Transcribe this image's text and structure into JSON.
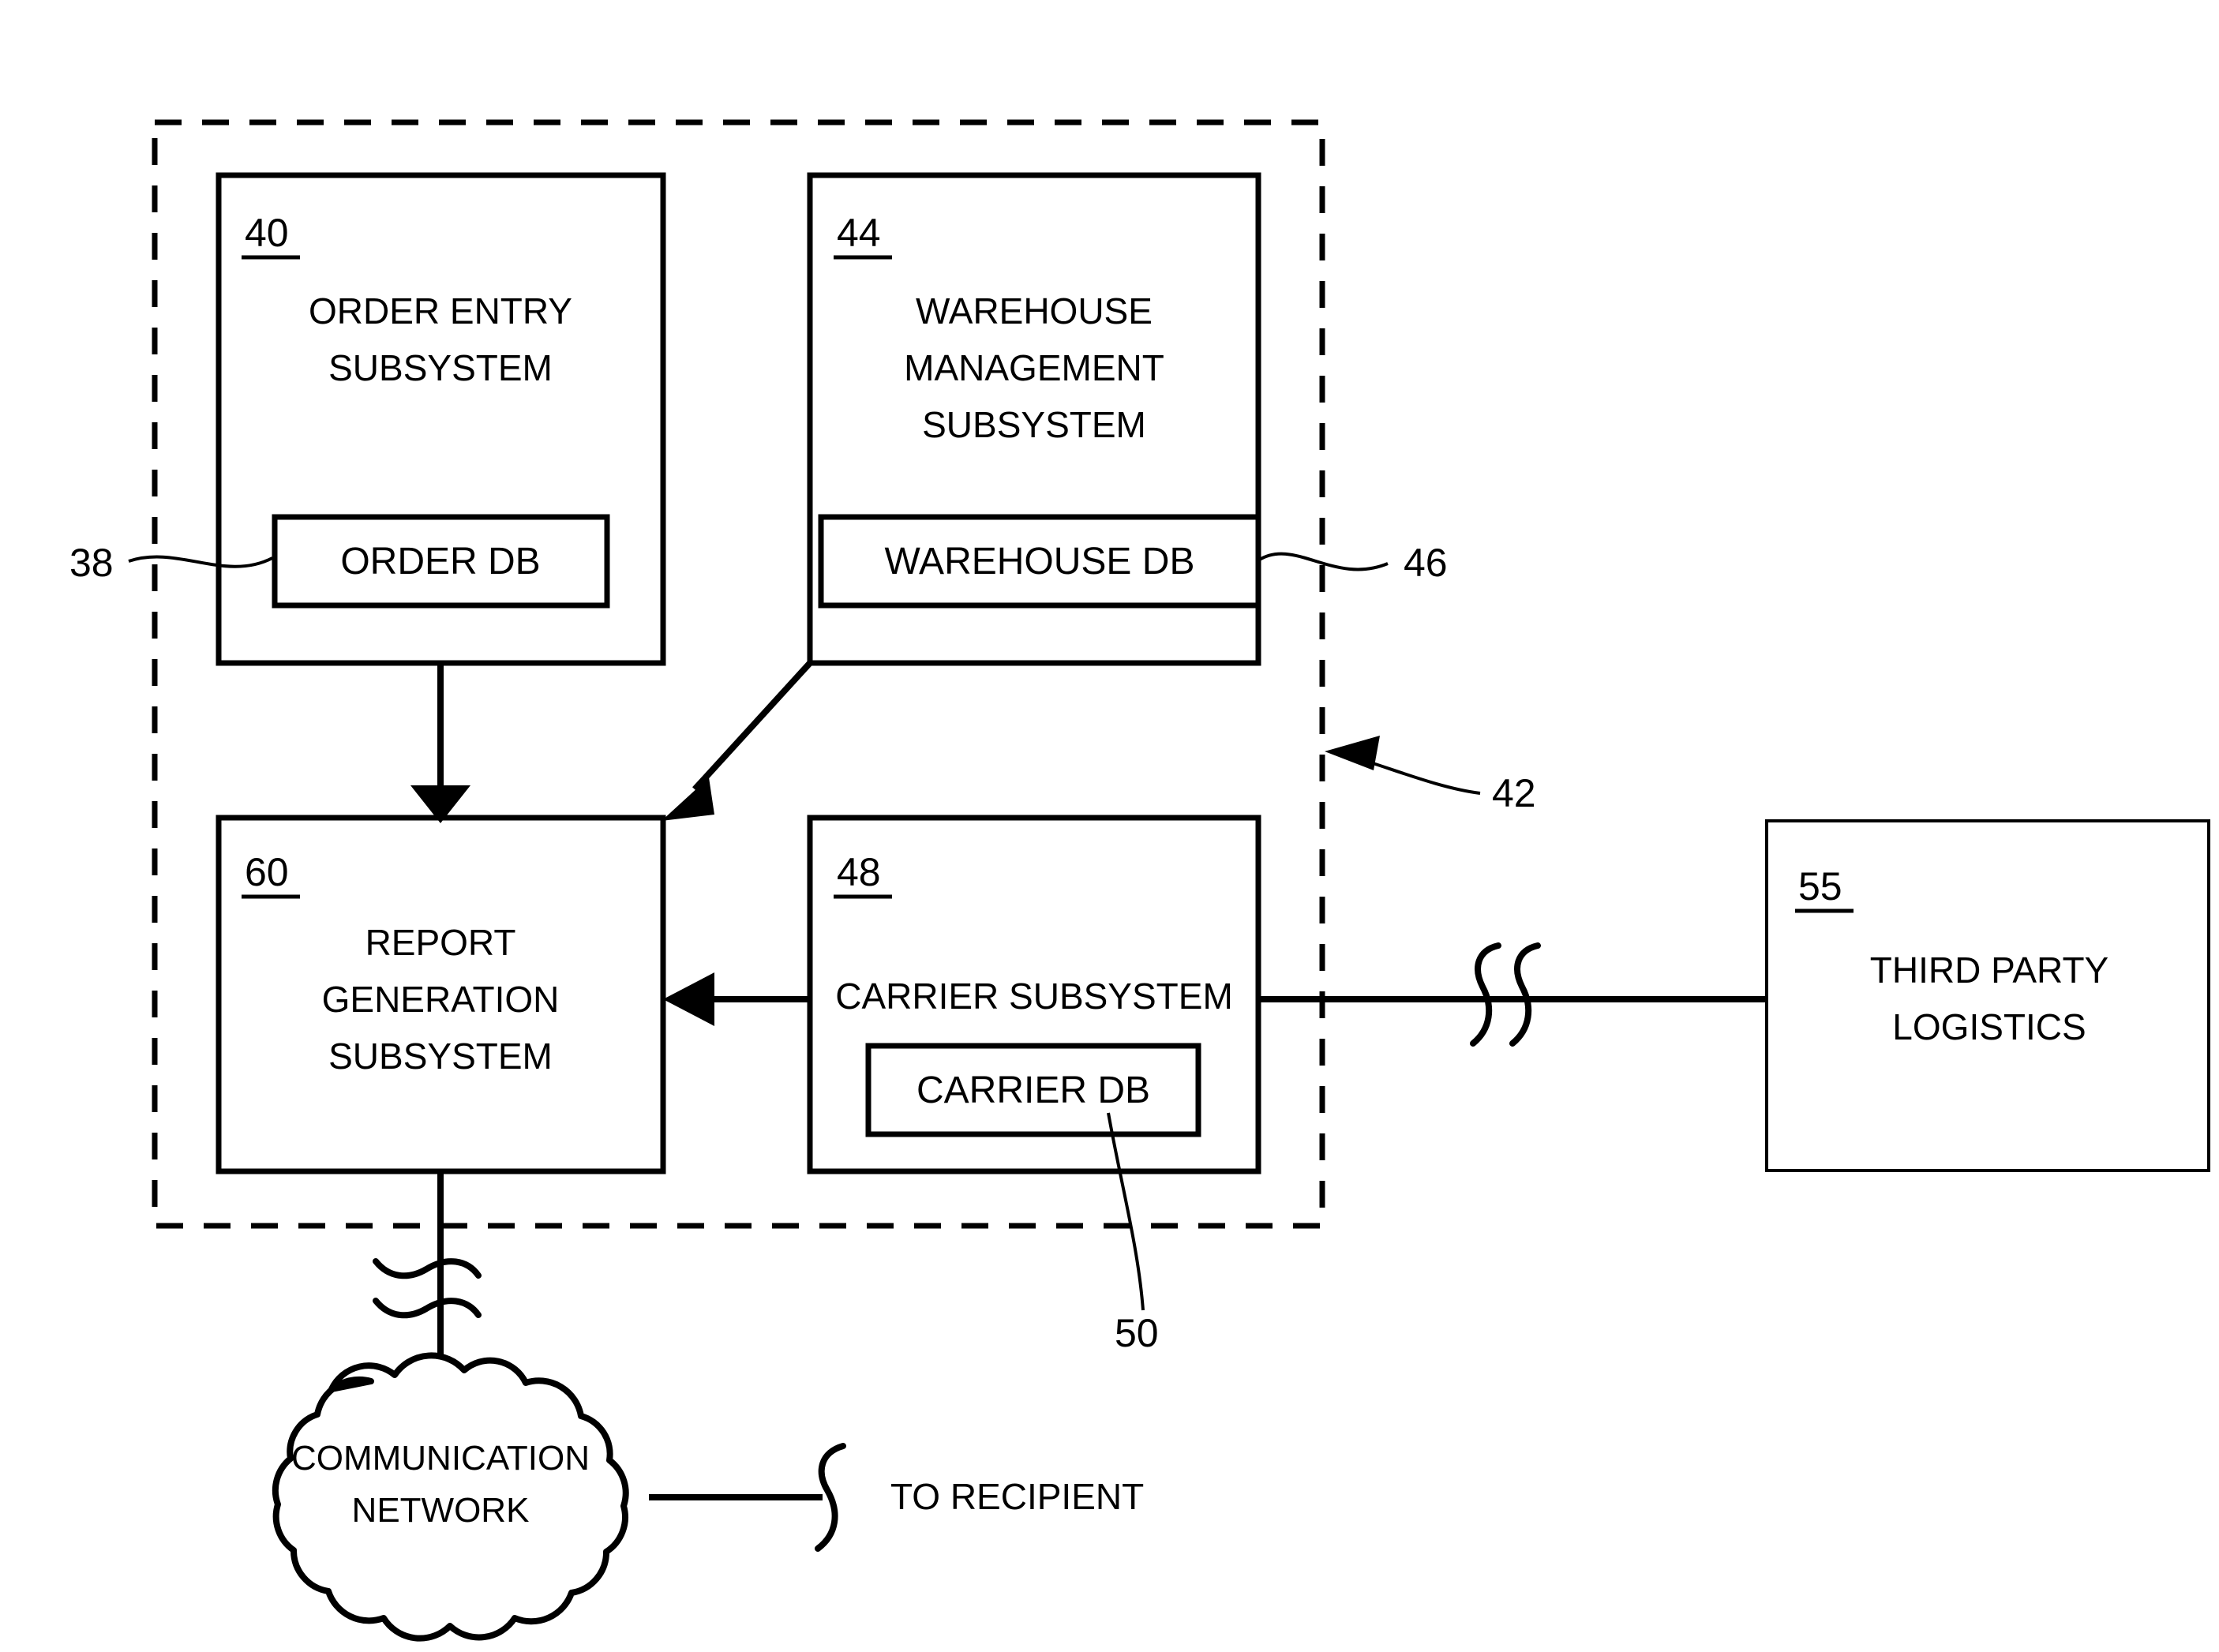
{
  "figure": {
    "kind": "patent-block-diagram",
    "ink_color": "#000000",
    "background_color": "#ffffff"
  },
  "system_boundary": {
    "ref": "42",
    "style": "dashed"
  },
  "blocks": {
    "order_entry": {
      "ref": "40",
      "title_line1": "ORDER ENTRY",
      "title_line2": "SUBSYSTEM",
      "database": {
        "label": "ORDER DB",
        "ref": "38"
      }
    },
    "warehouse_management": {
      "ref": "44",
      "title_line1": "WAREHOUSE",
      "title_line2": "MANAGEMENT",
      "title_line3": "SUBSYSTEM",
      "database": {
        "label": "WAREHOUSE DB",
        "ref": "46"
      }
    },
    "report_generation": {
      "ref": "60",
      "title_line1": "REPORT",
      "title_line2": "GENERATION",
      "title_line3": "SUBSYSTEM"
    },
    "carrier": {
      "ref": "48",
      "title_line1": "CARRIER SUBSYSTEM",
      "database": {
        "label": "CARRIER DB",
        "ref": "50"
      }
    },
    "third_party_logistics": {
      "ref": "55",
      "title_line1": "THIRD PARTY",
      "title_line2": "LOGISTICS"
    },
    "communication_network": {
      "title_line1": "COMMUNICATION",
      "title_line2": "NETWORK"
    }
  },
  "annotations": {
    "to_recipient": "TO RECIPIENT"
  },
  "connections": [
    {
      "name": "order-entry-to-report-generation",
      "from": "order_entry",
      "to": "report_generation",
      "arrow": "down"
    },
    {
      "name": "warehouse-to-report-generation",
      "from": "warehouse_management",
      "to": "report_generation",
      "arrow": "diagonal-down-left"
    },
    {
      "name": "carrier-to-report-generation",
      "from": "carrier",
      "to": "report_generation",
      "arrow": "left"
    },
    {
      "name": "carrier-to-third-party-logistics",
      "from": "carrier",
      "to": "third_party_logistics",
      "arrow": "none",
      "break_symbol": "double-squiggle"
    },
    {
      "name": "report-generation-to-network",
      "from": "report_generation",
      "to": "communication_network",
      "arrow": "none",
      "break_symbol": "double-squiggle"
    },
    {
      "name": "network-to-recipient",
      "from": "communication_network",
      "to": "to_recipient",
      "arrow": "none",
      "break_symbol": "single-squiggle"
    }
  ]
}
